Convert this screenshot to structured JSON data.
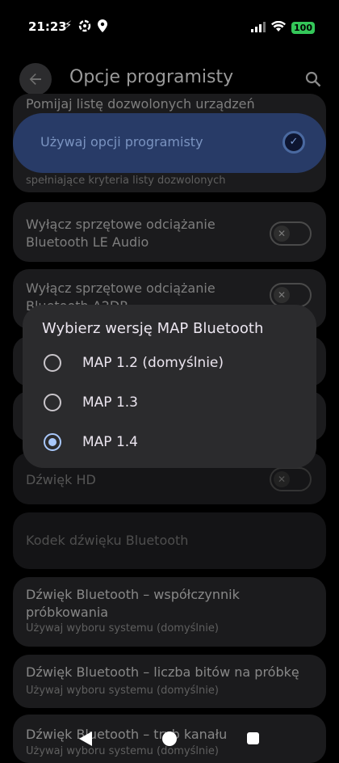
{
  "status_bar": {
    "time": "21:23",
    "battery": "100",
    "icons": [
      "flash-icon",
      "app-icon",
      "location-icon",
      "signal-icon",
      "wifi-icon",
      "battery-icon"
    ]
  },
  "app_bar": {
    "title": "Opcje programisty"
  },
  "dev_toggle": {
    "label": "Używaj opcji programisty",
    "checked": true
  },
  "list": {
    "item_allowlist": {
      "title": "Pomijaj listę dozwolonych urządzeń",
      "subtitle": "spełniające kryteria listy dozwolonych"
    },
    "item_le_audio": {
      "title_line1": "Wyłącz sprzętowe odciążanie",
      "title_line2": "Bluetooth LE Audio"
    },
    "item_a2dp": {
      "title_line1": "Wyłącz sprzętowe odciążanie",
      "title_line2": "Bluetooth A2DP"
    },
    "item_hd": {
      "title": "Dźwięk HD"
    },
    "item_codec": {
      "title": "Kodek dźwięku Bluetooth"
    },
    "item_sample_rate": {
      "title_line1": "Dźwięk Bluetooth – współczynnik",
      "title_line2": "próbkowania",
      "subtitle": "Używaj wyboru systemu (domyślnie)"
    },
    "item_bits": {
      "title": "Dźwięk Bluetooth – liczba bitów na próbkę",
      "subtitle": "Używaj wyboru systemu (domyślnie)"
    },
    "item_channel": {
      "title": "Dźwięk Bluetooth – tryb kanału",
      "subtitle": "Używaj wyboru systemu (domyślnie)"
    }
  },
  "dialog": {
    "title": "Wybierz wersję MAP Bluetooth",
    "options": [
      {
        "label": "MAP 1.2 (domyślnie)",
        "selected": false
      },
      {
        "label": "MAP 1.3",
        "selected": false
      },
      {
        "label": "MAP 1.4",
        "selected": true
      }
    ]
  },
  "colors": {
    "accent": "#a8c7fa",
    "dialog_bg": "#2b2b2d",
    "battery": "#34c759"
  }
}
